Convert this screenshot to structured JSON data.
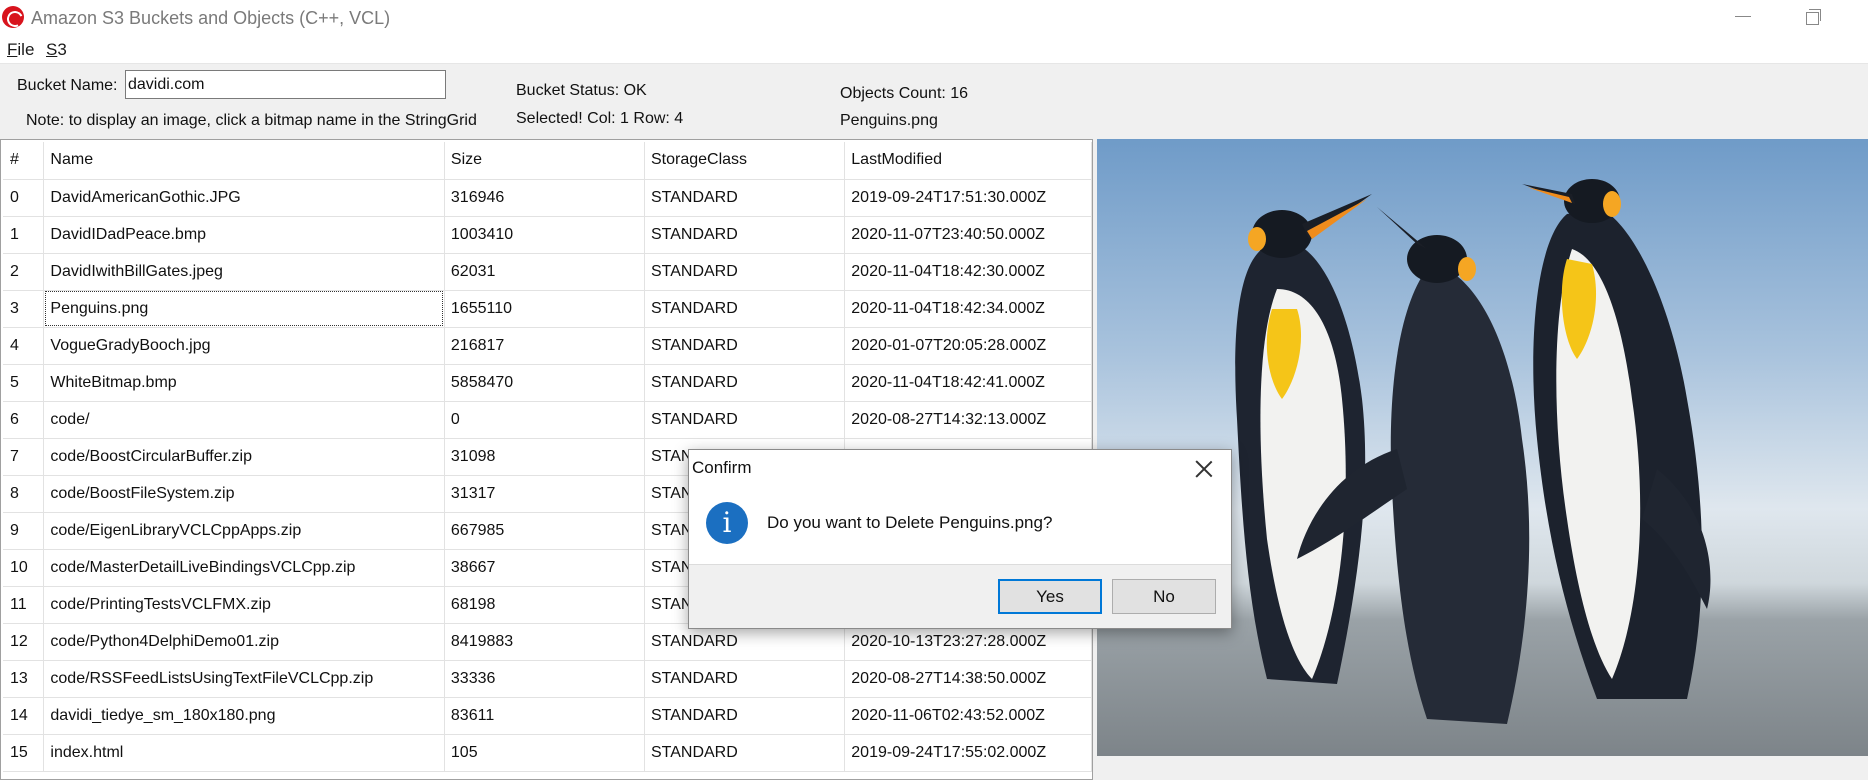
{
  "window": {
    "title": "Amazon S3 Buckets and Objects (C++, VCL)"
  },
  "menu": [
    {
      "label": "File"
    },
    {
      "label": "S3"
    }
  ],
  "panel": {
    "bucket_name_label": "Bucket Name:",
    "bucket_name_value": "davidi.com",
    "note": "Note: to display an image, click a bitmap name in the StringGrid",
    "bucket_status": "Bucket Status: OK",
    "selected": "Selected! Col: 1 Row: 4",
    "objects_count": "Objects Count: 16",
    "selected_file": "Penguins.png"
  },
  "grid": {
    "headers": [
      "#",
      "Name",
      "Size",
      "StorageClass",
      "LastModified"
    ],
    "rows": [
      [
        "0",
        "DavidAmericanGothic.JPG",
        "316946",
        "STANDARD",
        "2019-09-24T17:51:30.000Z"
      ],
      [
        "1",
        "DavidIDadPeace.bmp",
        "1003410",
        "STANDARD",
        "2020-11-07T23:40:50.000Z"
      ],
      [
        "2",
        "DavidIwithBillGates.jpeg",
        "62031",
        "STANDARD",
        "2020-11-04T18:42:30.000Z"
      ],
      [
        "3",
        "Penguins.png",
        "1655110",
        "STANDARD",
        "2020-11-04T18:42:34.000Z"
      ],
      [
        "4",
        "VogueGradyBooch.jpg",
        "216817",
        "STANDARD",
        "2020-01-07T20:05:28.000Z"
      ],
      [
        "5",
        "WhiteBitmap.bmp",
        "5858470",
        "STANDARD",
        "2020-11-04T18:42:41.000Z"
      ],
      [
        "6",
        "code/",
        "0",
        "STANDARD",
        "2020-08-27T14:32:13.000Z"
      ],
      [
        "7",
        "code/BoostCircularBuffer.zip",
        "31098",
        "STAN",
        ""
      ],
      [
        "8",
        "code/BoostFileSystem.zip",
        "31317",
        "STAN",
        ""
      ],
      [
        "9",
        "code/EigenLibraryVCLCppApps.zip",
        "667985",
        "STAN",
        ""
      ],
      [
        "10",
        "code/MasterDetailLiveBindingsVCLCpp.zip",
        "38667",
        "STAN",
        ""
      ],
      [
        "11",
        "code/PrintingTestsVCLFMX.zip",
        "68198",
        "STAN",
        ""
      ],
      [
        "12",
        "code/Python4DelphiDemo01.zip",
        "8419883",
        "STANDARD",
        "2020-10-13T23:27:28.000Z"
      ],
      [
        "13",
        "code/RSSFeedListsUsingTextFileVCLCpp.zip",
        "33336",
        "STANDARD",
        "2020-08-27T14:38:50.000Z"
      ],
      [
        "14",
        "davidi_tiedye_sm_180x180.png",
        "83611",
        "STANDARD",
        "2020-11-06T02:43:52.000Z"
      ],
      [
        "15",
        "index.html",
        "105",
        "STANDARD",
        "2019-09-24T17:55:02.000Z"
      ]
    ],
    "selected_row": 3
  },
  "dialog": {
    "title": "Confirm",
    "message": "Do you want to Delete Penguins.png?",
    "icon": "info-icon",
    "yes_label": "Yes",
    "no_label": "No"
  }
}
